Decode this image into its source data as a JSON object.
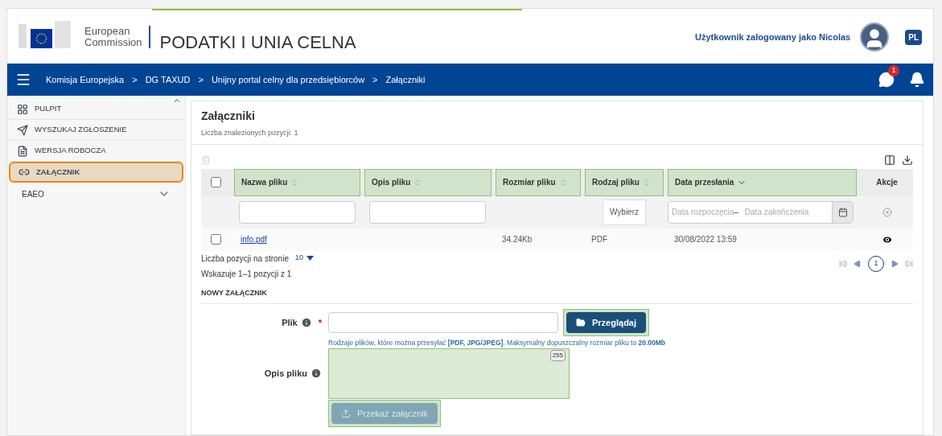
{
  "header": {
    "logo_line1": "European",
    "logo_line2": "Commission",
    "title": "PODATKI I UNIA CELNA",
    "user_label": "Użytkownik zalogowany jako Nicolas",
    "language": "PL"
  },
  "navbar": {
    "breadcrumbs": [
      "Komisja Europejska",
      "DG TAXUD",
      "Unijny portal celny dla przedsiębiorców",
      "Załączniki"
    ],
    "separator": ">",
    "message_count": "1"
  },
  "sidebar": {
    "items": [
      {
        "label": "PULPIT",
        "kind": "grid",
        "selected": false
      },
      {
        "label": "WYSZUKAJ ZGŁOSZENIE",
        "kind": "send",
        "selected": false
      },
      {
        "label": "WERSJA ROBOCZA",
        "kind": "file",
        "selected": false
      },
      {
        "label": "ZAŁĄCZNIK",
        "kind": "link",
        "selected": true
      },
      {
        "label": "EAEO",
        "kind": "group",
        "selected": false,
        "expanded": false
      }
    ]
  },
  "page": {
    "title": "Załączniki",
    "subtitle": "Liczba znalezionych pozycji: 1"
  },
  "table": {
    "columns": [
      {
        "label": "Nazwa pliku",
        "sortable": true,
        "sorted": false,
        "highlighted": true,
        "kind": "text"
      },
      {
        "label": "Opis pliku",
        "sortable": true,
        "sorted": false,
        "highlighted": true,
        "kind": "text"
      },
      {
        "label": "Rozmiar pliku",
        "sortable": true,
        "sorted": false,
        "highlighted": true,
        "kind": "plain"
      },
      {
        "label": "Rodzaj pliku",
        "sortable": true,
        "sorted": false,
        "highlighted": true,
        "kind": "select",
        "filter_label": "Wybierz"
      },
      {
        "label": "Data przesłania",
        "sortable": false,
        "sorted": true,
        "highlighted": true,
        "kind": "date",
        "placeholder_from": "Data rozpoczęcia",
        "placeholder_sep": "–",
        "placeholder_to": "Data zakończenia"
      },
      {
        "label": "Akcje",
        "sortable": false,
        "sorted": false,
        "highlighted": false,
        "kind": "actions"
      }
    ],
    "header_checked": false,
    "rows": [
      {
        "checked": false,
        "cells": [
          "info.pdf",
          "",
          "34.24Kb",
          "PDF",
          "30/08/2022 13:59"
        ]
      }
    ],
    "page_size_label": "Liczba pozycji na stronie",
    "page_size": "10",
    "range": "Wskazuje 1–1 pozycji z 1",
    "pages": [
      {
        "label": "1",
        "selected": true
      }
    ]
  },
  "form": {
    "section": "NOWY ZAŁĄCZNIK",
    "file_label": "Plik",
    "required_mark": "*",
    "browse": "Przeglądaj",
    "browse_highlighted": true,
    "hint": "Rodzaje plików, które można przesyłać **[PDF, JPG/JPEG]**. Maksymalny dopuszczalny rozmiar pliku to **20.00Mb**",
    "desc_label": "Opis pliku",
    "desc_counter": "255",
    "desc_highlighted": true,
    "submit": "Przekaż załącznik",
    "submit_disabled": true,
    "submit_highlighted": true
  }
}
